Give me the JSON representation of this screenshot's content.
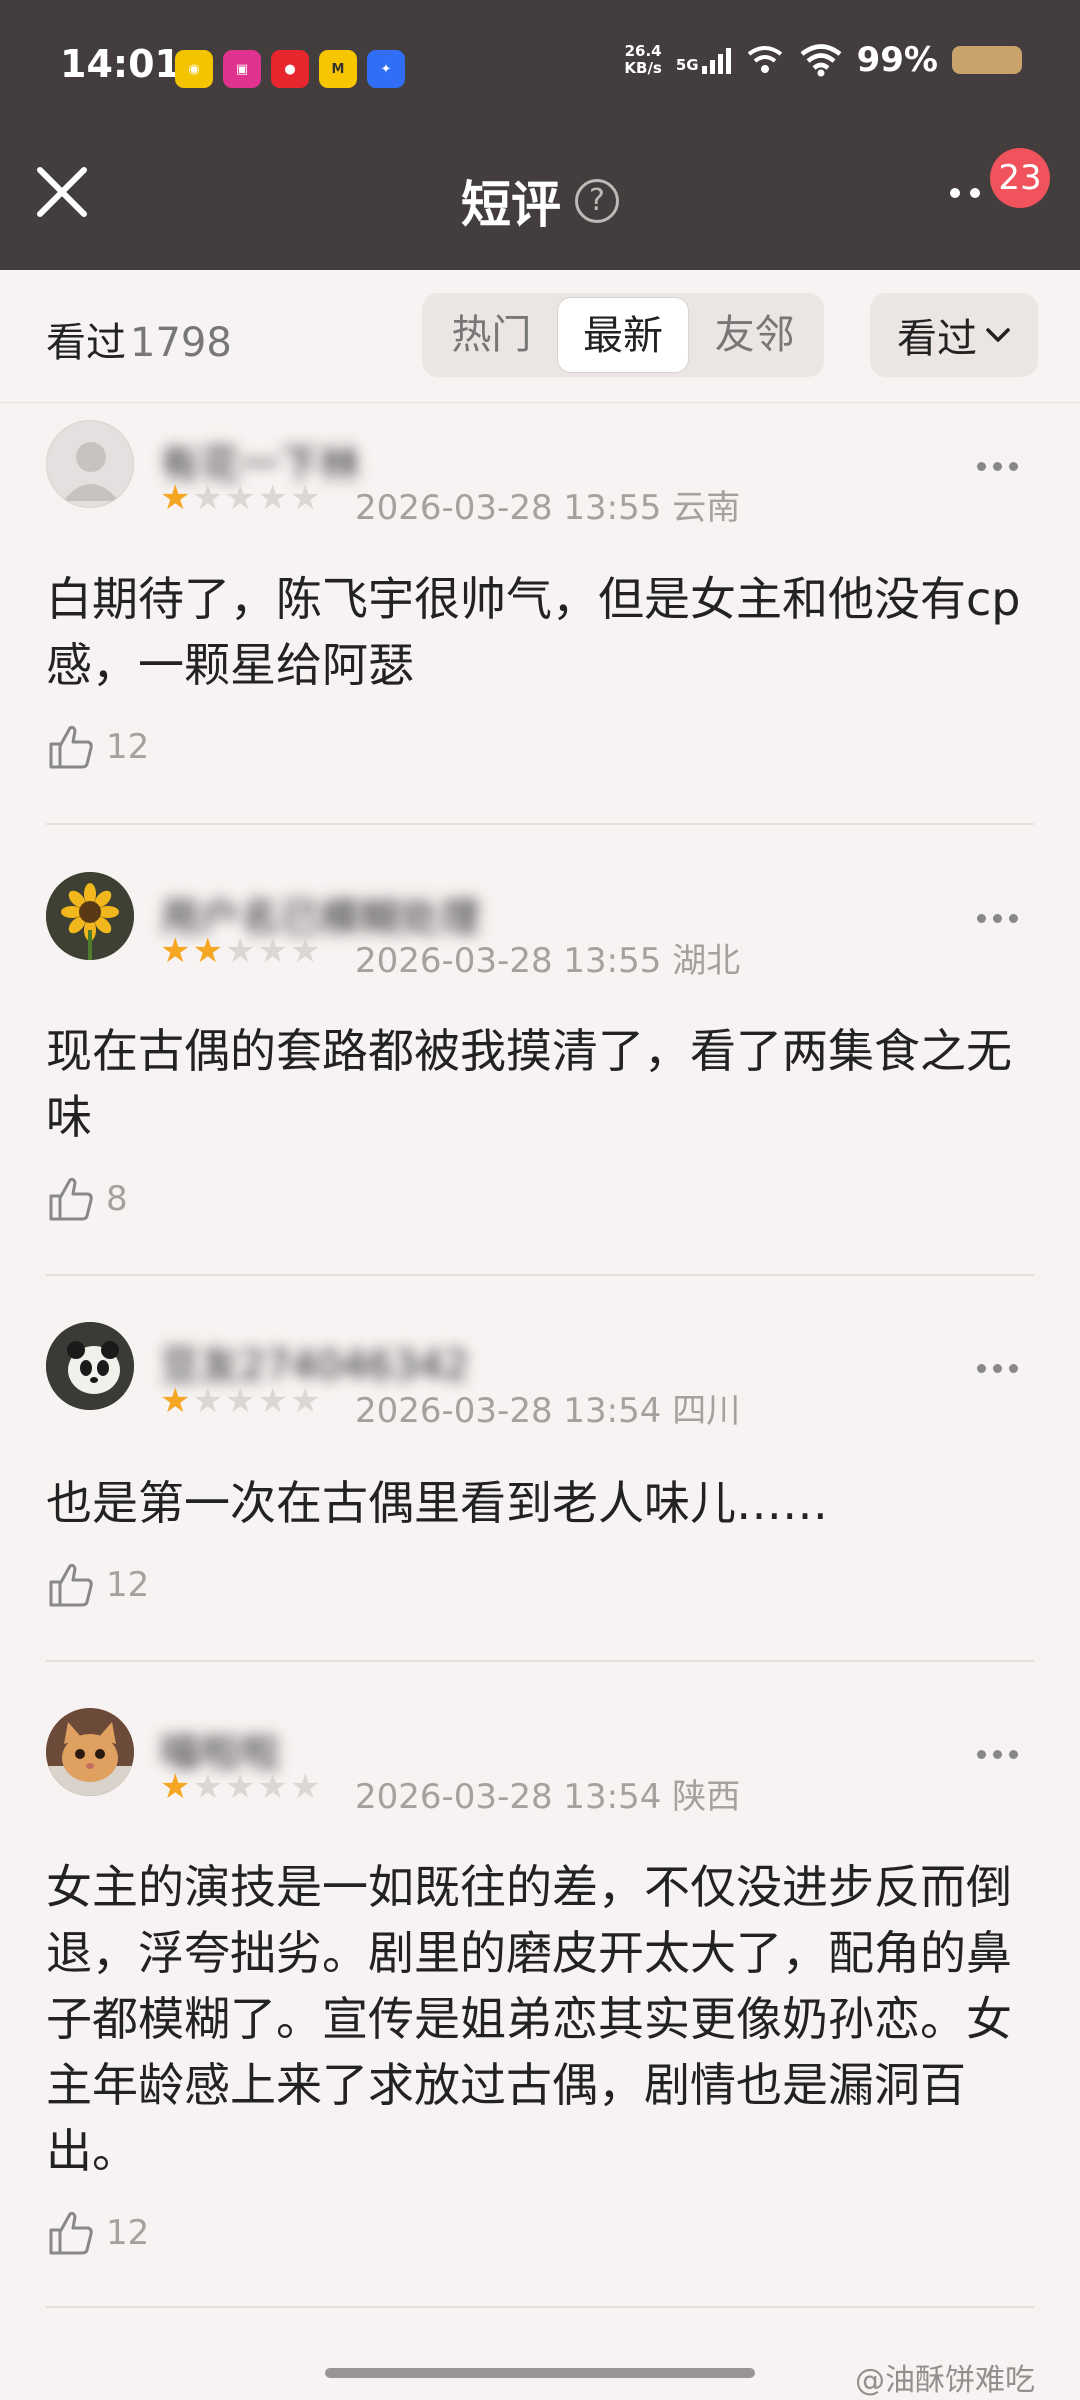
{
  "status_bar": {
    "time": "14:01",
    "net_speed_top": "26.4",
    "net_speed_bottom": "KB/s",
    "network": "5G",
    "battery": "99%"
  },
  "header": {
    "title": "短评",
    "help_icon": "?",
    "badge": "23"
  },
  "filter": {
    "seen_label": "看过",
    "seen_count": "1798",
    "tabs": [
      "热门",
      "最新",
      "友邻"
    ],
    "active_tab": "最新",
    "dropdown": "看过"
  },
  "reviews": [
    {
      "username": "有花一下林",
      "rating": 1,
      "date": "2026-03-28 13:55",
      "location": "云南",
      "text": "白期待了，陈飞宇很帅气，但是女主和他没有cp感，一颗星给阿瑟",
      "likes": "12"
    },
    {
      "username": "用户名已模糊处理",
      "rating": 2,
      "date": "2026-03-28 13:55",
      "location": "湖北",
      "text": "现在古偶的套路都被我摸清了，看了两集食之无味",
      "likes": "8"
    },
    {
      "username": "豆友274046342",
      "rating": 1,
      "date": "2026-03-28 13:54",
      "location": "四川",
      "text": "也是第一次在古偶里看到老人味儿……",
      "likes": "12"
    },
    {
      "username": "喵啦啦",
      "rating": 1,
      "date": "2026-03-28 13:54",
      "location": "陕西",
      "text": "女主的演技是一如既往的差，不仅没进步反而倒退，浮夸拙劣。剧里的磨皮开太大了，配角的鼻子都模糊了。宣传是姐弟恋其实更像奶孙恋。女主年龄感上来了求放过古偶，剧情也是漏洞百出。",
      "likes": "12"
    }
  ],
  "watermark": "@油酥饼难吃"
}
